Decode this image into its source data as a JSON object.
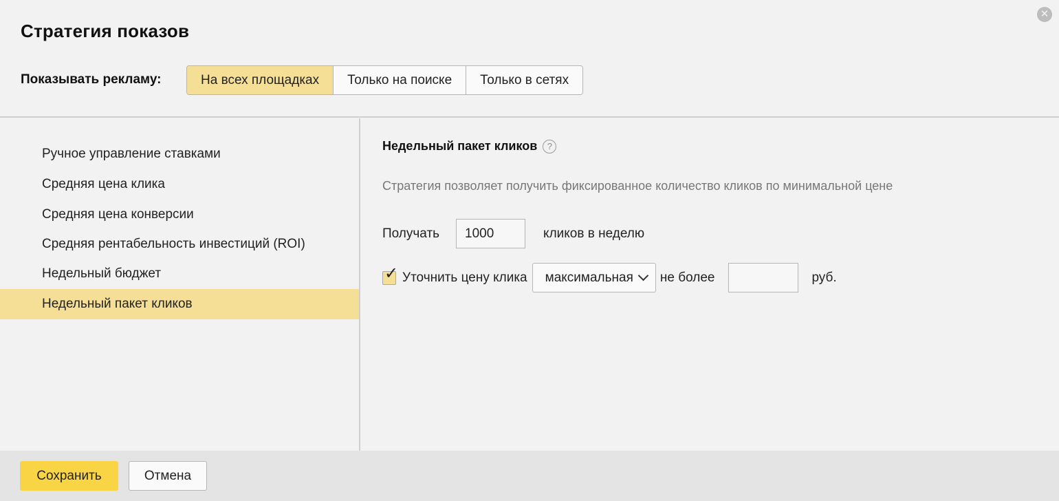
{
  "dialog": {
    "title": "Стратегия показов",
    "close_icon": "close-icon"
  },
  "placement": {
    "label": "Показывать рекламу:",
    "options": [
      {
        "label": "На всех площадках",
        "selected": true
      },
      {
        "label": "Только на поиске",
        "selected": false
      },
      {
        "label": "Только в сетях",
        "selected": false
      }
    ]
  },
  "strategies": {
    "items": [
      {
        "label": "Ручное управление ставками",
        "selected": false
      },
      {
        "label": "Средняя цена клика",
        "selected": false
      },
      {
        "label": "Средняя цена конверсии",
        "selected": false
      },
      {
        "label": "Средняя рентабельность инвестиций (ROI)",
        "selected": false
      },
      {
        "label": "Недельный бюджет",
        "selected": false
      },
      {
        "label": "Недельный пакет кликов",
        "selected": true
      }
    ]
  },
  "details": {
    "title": "Недельный пакет кликов",
    "help_icon": "question-circle-icon",
    "help_glyph": "?",
    "description": "Стратегия позволяет получить фиксированное количество кликов по минимальной цене",
    "receive_label": "Получать",
    "clicks_value": "1000",
    "clicks_suffix": "кликов в неделю",
    "refine_checked": true,
    "refine_label": "Уточнить цену клика",
    "price_mode": "максимальная",
    "not_more_label": "не более",
    "price_value": "",
    "currency": "руб."
  },
  "footer": {
    "save_label": "Сохранить",
    "cancel_label": "Отмена"
  },
  "colors": {
    "accent": "#f5df97",
    "primary_button": "#f9d545",
    "background": "#f2f2f2",
    "footer_background": "#e4e4e4"
  }
}
